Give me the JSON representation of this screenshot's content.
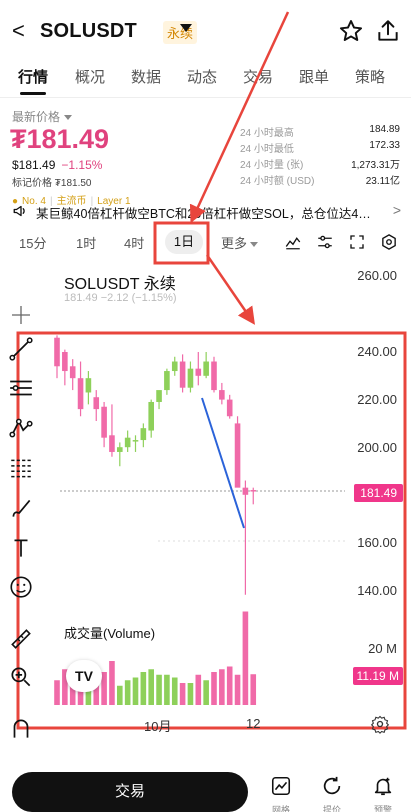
{
  "header": {
    "back": "<",
    "symbol": "SOLUSDT",
    "badge": "永续"
  },
  "tabs": [
    {
      "label": "行情"
    },
    {
      "label": "概况"
    },
    {
      "label": "数据"
    },
    {
      "label": "动态"
    },
    {
      "label": "交易"
    },
    {
      "label": "跟单"
    },
    {
      "label": "策略"
    }
  ],
  "price": {
    "latest_label": "最新价格",
    "big_price": "₮181.49",
    "sub_price": "$181.49",
    "change": "−1.15%",
    "mark_label": "标记价格",
    "mark_value": "₮181.50"
  },
  "stats": [
    {
      "label": "24 小时最高",
      "value": "184.89"
    },
    {
      "label": "24 小时最低",
      "value": "172.33"
    },
    {
      "label": "24 小时量 (张)",
      "value": "1,273.31万"
    },
    {
      "label": "24 小时额 (USD)",
      "value": "23.11亿"
    }
  ],
  "tags": {
    "rank": "No. 4",
    "category": "主流币",
    "layer": "Layer 1"
  },
  "news": {
    "text": "某巨鲸40倍杠杆做空BTC和20倍杠杆做空SOL，总仓位达4…",
    "more": ">"
  },
  "timeframes": {
    "items": [
      "15分",
      "1时",
      "4时",
      "1日"
    ],
    "active": "1日",
    "more": "更多"
  },
  "chart": {
    "title": "SOLUSDT 永续",
    "ohlc_ghost": "181.49 −2.12 (−1.15%)",
    "price_tag": "181.49",
    "volume_title": "成交量(Volume)",
    "volume_axis": "20 M",
    "volume_tag": "11.19 M",
    "x_labels": [
      "10月",
      "12"
    ],
    "logo": "TV"
  },
  "chart_data": {
    "type": "candlestick",
    "title": "SOLUSDT 永续",
    "y_ticks": [
      260,
      240,
      220,
      200,
      180,
      160,
      140
    ],
    "y_labels": [
      "260.00",
      "240.00",
      "220.00",
      "200.00",
      "160.00",
      "140.00"
    ],
    "ylim": [
      130,
      265
    ],
    "last_price": 181.49,
    "candles": [
      {
        "o": 246,
        "h": 247,
        "l": 229,
        "c": 234
      },
      {
        "o": 240,
        "h": 241,
        "l": 226,
        "c": 232
      },
      {
        "o": 234,
        "h": 237,
        "l": 224,
        "c": 229
      },
      {
        "o": 229,
        "h": 236,
        "l": 213,
        "c": 216
      },
      {
        "o": 223,
        "h": 232,
        "l": 218,
        "c": 229
      },
      {
        "o": 221,
        "h": 224,
        "l": 211,
        "c": 216
      },
      {
        "o": 217,
        "h": 219,
        "l": 200,
        "c": 204
      },
      {
        "o": 205,
        "h": 218,
        "l": 196,
        "c": 198
      },
      {
        "o": 198,
        "h": 202,
        "l": 192,
        "c": 200
      },
      {
        "o": 200,
        "h": 207,
        "l": 198,
        "c": 204
      },
      {
        "o": 203,
        "h": 205,
        "l": 198,
        "c": 203
      },
      {
        "o": 203,
        "h": 210,
        "l": 200,
        "c": 208
      },
      {
        "o": 207,
        "h": 220,
        "l": 204,
        "c": 219
      },
      {
        "o": 219,
        "h": 223,
        "l": 216,
        "c": 224
      },
      {
        "o": 224,
        "h": 233,
        "l": 222,
        "c": 232
      },
      {
        "o": 232,
        "h": 238,
        "l": 230,
        "c": 236
      },
      {
        "o": 236,
        "h": 239,
        "l": 223,
        "c": 225
      },
      {
        "o": 225,
        "h": 236,
        "l": 223,
        "c": 233
      },
      {
        "o": 233,
        "h": 240,
        "l": 226,
        "c": 230
      },
      {
        "o": 230,
        "h": 240,
        "l": 229,
        "c": 236
      },
      {
        "o": 236,
        "h": 238,
        "l": 223,
        "c": 224
      },
      {
        "o": 224,
        "h": 227,
        "l": 218,
        "c": 220
      },
      {
        "o": 220,
        "h": 222,
        "l": 212,
        "c": 213
      },
      {
        "o": 210,
        "h": 213,
        "l": 190,
        "c": 183
      },
      {
        "o": 183,
        "h": 186,
        "l": 138,
        "c": 180
      },
      {
        "o": 182,
        "h": 183,
        "l": 176,
        "c": 181.49
      }
    ],
    "volume": [
      9,
      13,
      8,
      7,
      10,
      11,
      12,
      16,
      7,
      9,
      10,
      12,
      13,
      11,
      11,
      10,
      8,
      8,
      11,
      9,
      12,
      13,
      14,
      11,
      34,
      11.19
    ],
    "volume_unit": "M",
    "volume_ylim": [
      0,
      34
    ]
  },
  "bottom_bar": {
    "trade": "交易",
    "actions": [
      {
        "label": "网格",
        "icon": "grid-chart-icon"
      },
      {
        "label": "提价",
        "icon": "refresh-icon"
      },
      {
        "label": "预警",
        "icon": "alarm-bell-icon"
      }
    ]
  }
}
